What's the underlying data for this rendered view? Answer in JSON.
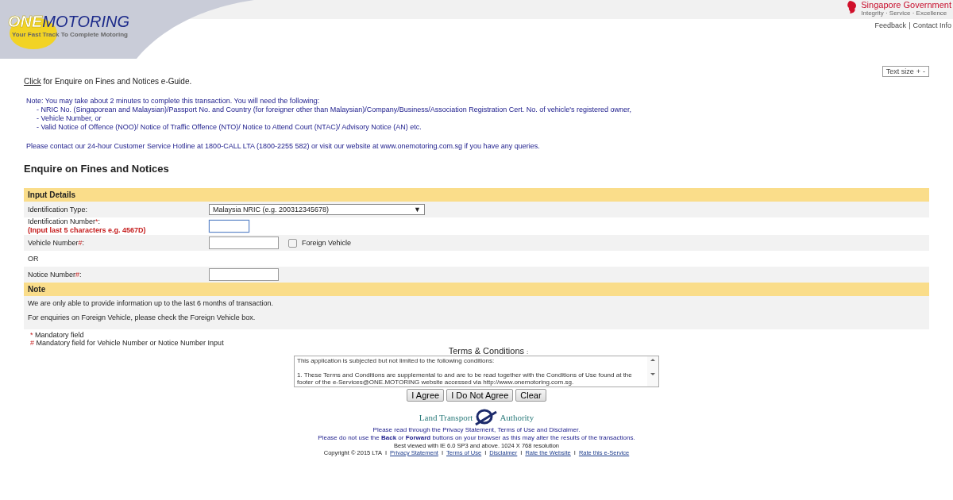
{
  "header": {
    "logo_one": "ONE",
    "logo_motoring": "MOTORING",
    "tagline": "Your Fast Track To Complete Motoring",
    "gov_name": "Singapore Government",
    "gov_motto": "Integrity · Service · Excellence",
    "links": [
      "Feedback",
      "Contact Info"
    ],
    "separator": "|"
  },
  "text_size": {
    "label": "Text size",
    "plus": "+",
    "minus": "-"
  },
  "guide": {
    "link": "Click",
    "text": "for Enquire on Fines and Notices e-Guide."
  },
  "note": {
    "intro": "Note: You may take about 2 minutes to complete this transaction. You will need the following:",
    "items": [
      "- NRIC No. (Singaporean and Malaysian)/Passport No. and Country (for foreigner other than Malaysian)/Company/Business/Association Registration Cert. No. of vehicle's registered owner,",
      "- Vehicle Number, or",
      "- Valid Notice of Offence (NOO)/ Notice of Traffic Offence (NTO)/ Notice to Attend Court (NTAC)/ Advisory Notice (AN) etc."
    ],
    "contact": "Please contact our 24-hour Customer Service Hotline at 1800-CALL LTA (1800-2255 582) or visit our website at www.onemotoring.com.sg if you have any queries."
  },
  "heading": "Enquire on Fines and Notices",
  "input_details": {
    "title": "Input Details",
    "rows": [
      {
        "kind": "select",
        "label": "Identification Type:",
        "value": "Malaysia NRIC (e.g. 200312345678)",
        "caret": "▼"
      },
      {
        "kind": "input",
        "label": "Identification Number",
        "mark": "*",
        "suffix": ":",
        "hint": "(Input last 5 characters e.g. 4567D)",
        "focused": true
      },
      {
        "kind": "input_checkbox",
        "label": "Vehicle Number",
        "mark": "#",
        "suffix": ":",
        "focused": false,
        "checkbox": {
          "label": "Foreign Vehicle",
          "checked": false
        }
      },
      {
        "kind": "separator",
        "label": "OR"
      },
      {
        "kind": "input",
        "label": "Notice Number",
        "mark": "#",
        "suffix": ":",
        "focused": false
      }
    ]
  },
  "note_section": {
    "title": "Note",
    "lines": [
      "We are only able to provide information up to the last 6 months of transaction.",
      "For enquiries on Foreign Vehicle, please check the Foreign Vehicle box."
    ]
  },
  "legend": [
    {
      "mark": "*",
      "text": "Mandatory field"
    },
    {
      "mark": "#",
      "text": "Mandatory field for Vehicle Number or Notice Number Input"
    }
  ],
  "terms": {
    "title": "Terms & Conditions",
    "colon": ":",
    "paragraphs": [
      "This application is subjected but not limited to the following conditions:",
      "1.  These Terms and Conditions are supplemental to and are to be read together with the Conditions of Use found at the footer of the e-Services@ONE.MOTORING website accessed via http://www.onemotoring.com.sg."
    ]
  },
  "buttons": [
    "I Agree",
    "I Do Not Agree",
    "Clear"
  ],
  "lta_logo": {
    "left": "Land Transport",
    "right": "Authority"
  },
  "footer": {
    "line_1": "Please read through the Privacy Statement, Terms of Use and Disclaimer.",
    "line_2": "Please do not use the **Back** or **Forward** buttons on your browser as this may alter the results of the transactions.",
    "line_3": "Best viewed with IE 6.0 SP3 and above. 1024 X 768 resolution",
    "copyright": "Copyright © 2015 LTA",
    "links": [
      {
        "separator": "I",
        "label": "Privacy Statement"
      },
      {
        "separator": "I",
        "label": "Terms of Use"
      },
      {
        "separator": "I",
        "label": "Disclaimer"
      },
      {
        "separator": "I",
        "label": "Rate the Website"
      },
      {
        "separator": "I",
        "label": "Rate this e-Service"
      }
    ]
  }
}
